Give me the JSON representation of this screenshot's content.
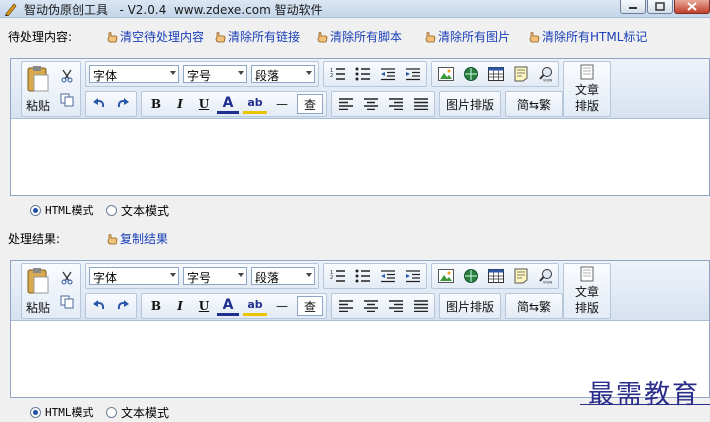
{
  "window": {
    "title": "智动伪原创工具   - V2.0.4  www.zdexe.com 智动软件"
  },
  "input_section": {
    "label": "待处理内容:",
    "actions": [
      {
        "label": "清空待处理内容"
      },
      {
        "label": "清除所有链接"
      },
      {
        "label": "清除所有脚本"
      },
      {
        "label": "清除所有图片"
      },
      {
        "label": "清除所有HTML标记"
      }
    ]
  },
  "output_section": {
    "label": "处理结果:",
    "actions": [
      {
        "label": "复制结果"
      }
    ]
  },
  "toolbar": {
    "paste_label": "粘贴",
    "font_select": "字体",
    "size_select": "字号",
    "paragraph_select": "段落",
    "bold": "B",
    "italic": "I",
    "underline": "U",
    "font_color": "A",
    "highlight": "ab",
    "hr": "—",
    "find": "查",
    "image_layout": "图片排版",
    "convert": "简⇆繁",
    "article_layout_1": "文章",
    "article_layout_2": "排版"
  },
  "modes": {
    "html": "HTML模式",
    "text": "文本模式",
    "selected": "html"
  },
  "watermark": "最需教育",
  "colors": {
    "link": "#1a3fb8",
    "toolbar_bg": "#dfe8f3",
    "border": "#8ea6c3"
  }
}
